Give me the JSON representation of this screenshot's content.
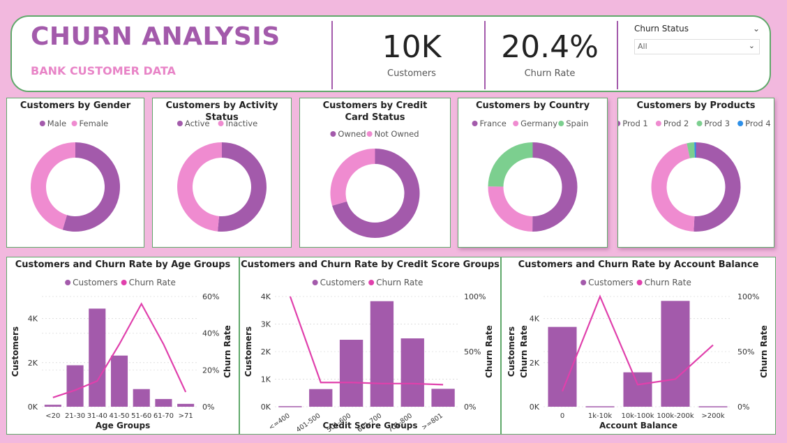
{
  "header": {
    "title": "CHURN ANALYSIS",
    "subtitle": "BANK CUSTOMER DATA",
    "kpis": [
      {
        "value": "10K",
        "label": "Customers"
      },
      {
        "value": "20.4%",
        "label": "Churn Rate"
      }
    ],
    "slicer": {
      "title": "Churn Status",
      "value": "All"
    }
  },
  "colors": {
    "purple": "#a35aab",
    "pink": "#ef8bd0",
    "green": "#7ccf8f",
    "blue": "#2d8fe8",
    "line": "#e040ac",
    "accent_title": "#a35aab",
    "accent_subtitle": "#e884c7"
  },
  "chart_data": [
    {
      "type": "pie",
      "donut": true,
      "title": "Customers by Gender",
      "legend": [
        "Male",
        "Female"
      ],
      "values": [
        54.6,
        45.4
      ],
      "colors": [
        "#a35aab",
        "#ef8bd0"
      ]
    },
    {
      "type": "pie",
      "donut": true,
      "title": "Customers by Activity Status",
      "legend": [
        "Active",
        "Inactive"
      ],
      "values": [
        51.5,
        48.5
      ],
      "colors": [
        "#a35aab",
        "#ef8bd0"
      ]
    },
    {
      "type": "pie",
      "donut": true,
      "title": "Customers by Credit Card Status",
      "legend": [
        "Owned",
        "Not Owned"
      ],
      "values": [
        70.5,
        29.5
      ],
      "colors": [
        "#a35aab",
        "#ef8bd0"
      ]
    },
    {
      "type": "pie",
      "donut": true,
      "title": "Customers by Country",
      "legend": [
        "France",
        "Germany",
        "Spain"
      ],
      "values": [
        50.1,
        25.1,
        24.8
      ],
      "colors": [
        "#a35aab",
        "#ef8bd0",
        "#7ccf8f"
      ]
    },
    {
      "type": "pie",
      "donut": true,
      "title": "Customers by Products",
      "legend": [
        "Prod 1",
        "Prod 2",
        "Prod 3",
        "Prod 4"
      ],
      "values": [
        50.8,
        45.9,
        2.7,
        0.6
      ],
      "colors": [
        "#a35aab",
        "#ef8bd0",
        "#7ccf8f",
        "#2d8fe8"
      ]
    },
    {
      "type": "bar",
      "title": "Customers and Churn Rate by Age Groups",
      "legend": [
        "Customers",
        "Churn Rate"
      ],
      "categories": [
        "<20",
        "21-30",
        "31-40",
        "41-50",
        "51-60",
        "61-70",
        ">71"
      ],
      "values": [
        90,
        1880,
        4450,
        2320,
        800,
        350,
        130
      ],
      "line": [
        5,
        9,
        14,
        34,
        56,
        34,
        8
      ],
      "xlabel": "Age Groups",
      "ylabel": "Customers",
      "y2label": "Churn Rate",
      "ylim": [
        0,
        5000
      ],
      "y2lim": [
        0,
        60
      ],
      "yticks": [
        0,
        2000,
        4000
      ],
      "yticklabels": [
        "0K",
        "2K",
        "4K"
      ],
      "y2ticks": [
        0,
        20,
        40,
        60
      ],
      "y2ticklabels": [
        "0%",
        "20%",
        "40%",
        "60%"
      ],
      "xrot": 0
    },
    {
      "type": "bar",
      "title": "Customers and Churn Rate by Credit Score Groups",
      "legend": [
        "Customers",
        "Churn Rate"
      ],
      "categories": [
        "<=400",
        "401-500",
        "501-600",
        "601-700",
        "701-800",
        ">=801"
      ],
      "values": [
        20,
        640,
        2430,
        3830,
        2480,
        650
      ],
      "line": [
        100,
        22,
        22,
        21,
        21,
        20
      ],
      "xlabel": "Credit Score Groups",
      "ylabel": "Customers",
      "y2label": "Churn Rate",
      "ylim": [
        0,
        4000
      ],
      "y2lim": [
        0,
        100
      ],
      "yticks": [
        0,
        1000,
        2000,
        3000,
        4000
      ],
      "yticklabels": [
        "0K",
        "1K",
        "2K",
        "3K",
        "4K"
      ],
      "y2ticks": [
        0,
        50,
        100
      ],
      "y2ticklabels": [
        "0%",
        "50%",
        "100%"
      ],
      "xrot": -35
    },
    {
      "type": "bar",
      "title": "Customers and Churn Rate by Account Balance",
      "legend": [
        "Customers",
        "Churn Rate"
      ],
      "categories": [
        "0",
        "1k-10k",
        "10k-100k",
        "100k-200k",
        ">200k"
      ],
      "values": [
        3620,
        20,
        1560,
        4800,
        20
      ],
      "line": [
        14,
        100,
        20,
        25,
        56
      ],
      "xlabel": "Account Balance",
      "ylabel": "Customers",
      "ylabel2": "Churn Rate",
      "y2label": "Churn Rate",
      "ylim": [
        0,
        5000
      ],
      "y2lim": [
        0,
        100
      ],
      "yticks": [
        0,
        2000,
        4000
      ],
      "yticklabels": [
        "0K",
        "2K",
        "4K"
      ],
      "y2ticks": [
        0,
        50,
        100
      ],
      "y2ticklabels": [
        "0%",
        "50%",
        "100%"
      ],
      "xrot": 0
    }
  ]
}
